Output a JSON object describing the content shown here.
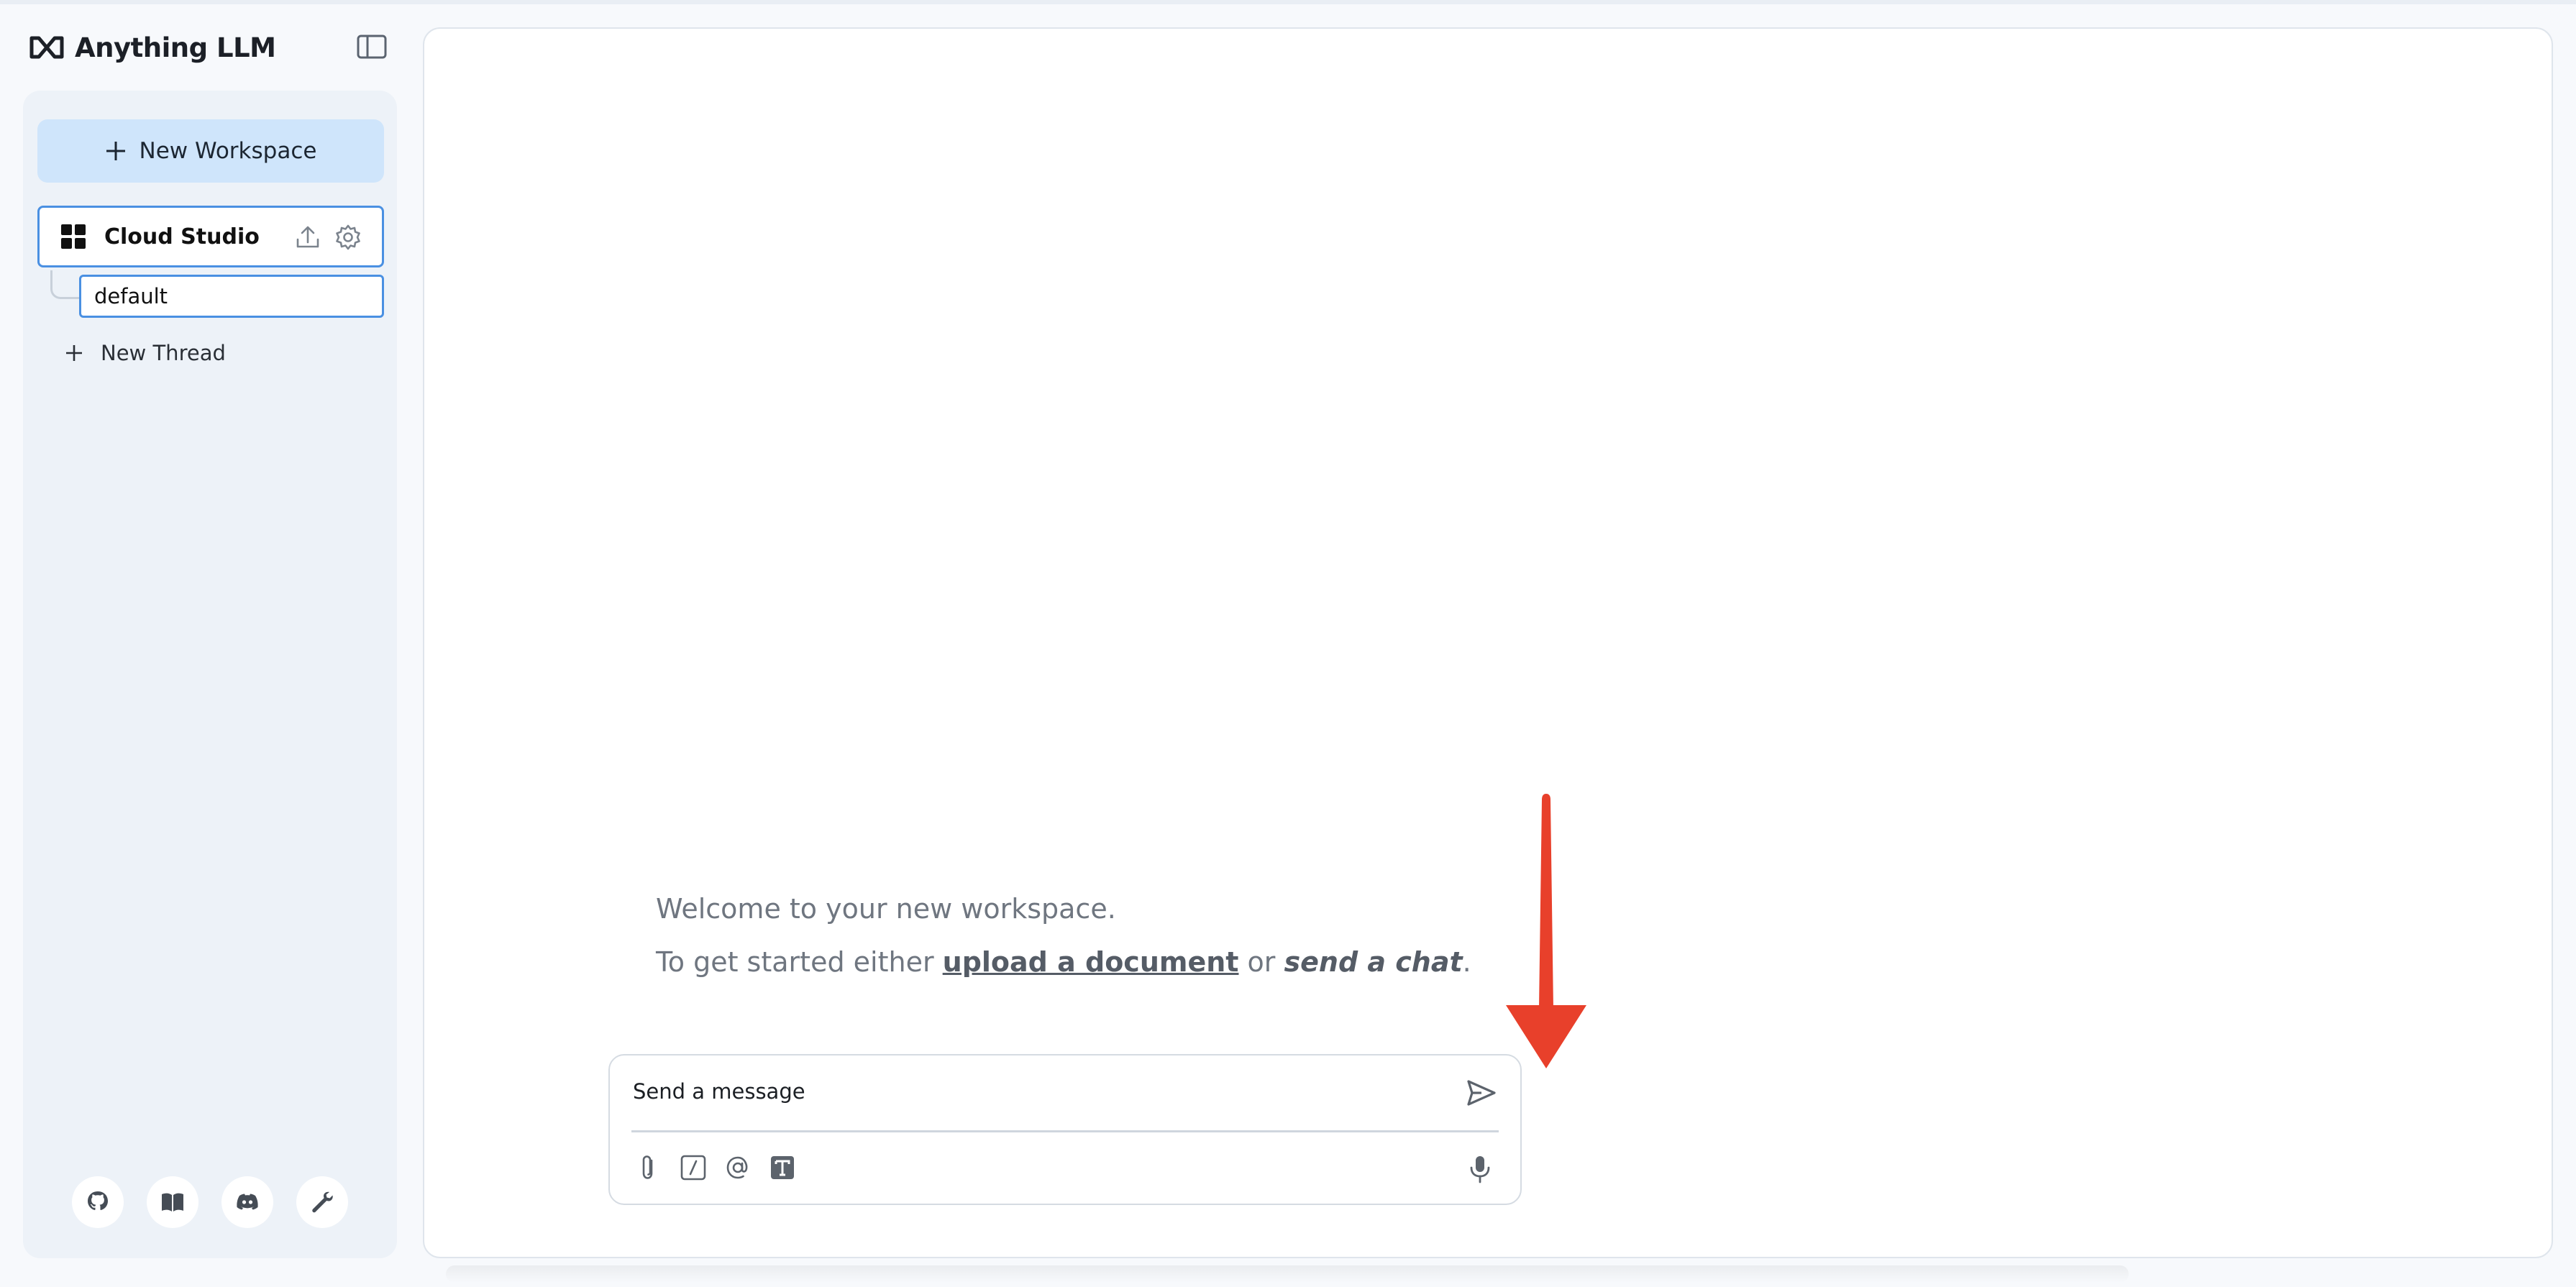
{
  "app": {
    "name": "Anything LLM"
  },
  "sidebar": {
    "new_workspace_label": "New Workspace",
    "workspace": {
      "name": "Cloud Studio",
      "threads": [
        {
          "label": "default"
        }
      ]
    },
    "new_thread_label": "New Thread",
    "footer_icons": [
      "github-icon",
      "book-icon",
      "discord-icon",
      "wrench-icon"
    ]
  },
  "main": {
    "welcome_title": "Welcome to your new workspace.",
    "welcome_prefix": "To get started either ",
    "upload_link": "upload a document",
    "welcome_middle": " or ",
    "chat_link": "send a chat",
    "welcome_suffix": "."
  },
  "composer": {
    "placeholder": "Send a message",
    "tools": [
      "paperclip-icon",
      "slash-command-icon",
      "at-mention-icon",
      "text-size-icon"
    ]
  },
  "colors": {
    "accent": "#4a90e2",
    "new_workspace_bg": "#cfe5fb",
    "annotation_arrow": "#e8402b"
  }
}
